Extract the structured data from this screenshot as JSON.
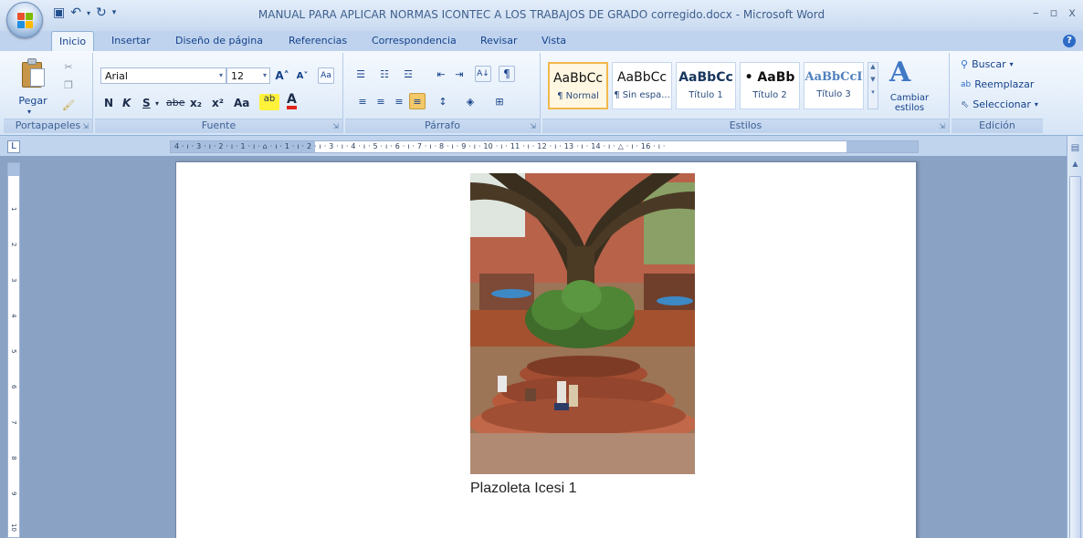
{
  "window": {
    "title": "MANUAL PARA APLICAR NORMAS ICONTEC A LOS TRABAJOS DE GRADO corregido.docx - Microsoft Word"
  },
  "tabs": [
    "Inicio",
    "Insertar",
    "Diseño de página",
    "Referencias",
    "Correspondencia",
    "Revisar",
    "Vista"
  ],
  "ribbon": {
    "portapapeles": {
      "label": "Portapapeles",
      "paste": "Pegar"
    },
    "fuente": {
      "label": "Fuente",
      "font_name": "Arial",
      "font_size": "12",
      "bold": "N",
      "italic": "K",
      "underline": "S",
      "strike": "abe",
      "sub": "x₂",
      "sup": "x²",
      "case": "Aa"
    },
    "parrafo": {
      "label": "Párrafo"
    },
    "estilos": {
      "label": "Estilos",
      "items": [
        {
          "sample": "AaBbCc",
          "name": "¶ Normal"
        },
        {
          "sample": "AaBbCc",
          "name": "¶ Sin espa..."
        },
        {
          "sample": "AaBbCc",
          "name": "Título 1"
        },
        {
          "sample": "• AaBb",
          "name": "Título 2"
        },
        {
          "sample": "AaBbCcI",
          "name": "Título 3"
        }
      ],
      "change_styles": "Cambiar estilos"
    },
    "edicion": {
      "label": "Edición",
      "find": "Buscar",
      "replace": "Reemplazar",
      "select": "Seleccionar"
    }
  },
  "ruler": {
    "horizontal": "4 · ı · 3 · ı · 2 · ı · 1 · ı · ⌂ · ı · 1 · ı · 2 · ı · 3 · ı · 4 · ı · 5 · ı · 6 · ı · 7 · ı · 8 · ı · 9 · ı · 10 · ı · 11 · ı · 12 · ı · 13 · ı · 14 · ı · △ · ı · 16 · ı ·",
    "vertical": [
      "1",
      "2",
      "3",
      "4",
      "5",
      "6",
      "7",
      "8",
      "9",
      "10"
    ]
  },
  "document": {
    "caption": "Plazoleta Icesi 1"
  },
  "colors": {
    "ribbon_bg": "#e4eefa",
    "accent": "#15428b",
    "workspace": "#8aa3c4"
  }
}
